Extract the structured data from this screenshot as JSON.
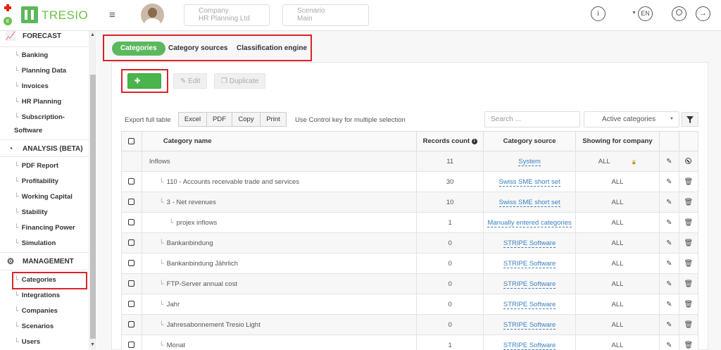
{
  "app": {
    "name": "TRESIO"
  },
  "header": {
    "company_label": "Company",
    "company_value": "HR Planning Ltd",
    "scenario_label": "Scenario",
    "scenario_value": "Main",
    "language": "EN"
  },
  "sidebar": {
    "sections": [
      {
        "title": "FORECAST",
        "icon": "chart-line-icon"
      },
      {
        "title": "ANALYSIS (BETA)",
        "icon": "pie-chart-icon"
      },
      {
        "title": "MANAGEMENT",
        "icon": "gear-icon"
      }
    ],
    "forecast_items": [
      "Banking",
      "Planning Data",
      "Invoices",
      "HR Planning",
      "Subscription-",
      "Software"
    ],
    "analysis_items": [
      "PDF Report",
      "Profitability",
      "Working Capital",
      "Stability",
      "Financing Power",
      "Simulation"
    ],
    "management_items": [
      "Categories",
      "Integrations",
      "Companies",
      "Scenarios",
      "Users"
    ]
  },
  "tabs": [
    {
      "label": "Categories",
      "active": true
    },
    {
      "label": "Category sources",
      "active": false
    },
    {
      "label": "Classification engine",
      "active": false
    }
  ],
  "toolbar": {
    "new_label": "New",
    "edit_label": "Edit",
    "duplicate_label": "Duplicate"
  },
  "export": {
    "label": "Export full table",
    "buttons": [
      "Excel",
      "PDF",
      "Copy",
      "Print"
    ],
    "hint": "Use Control key for multiple selection"
  },
  "search": {
    "placeholder": "Search ..."
  },
  "filter": {
    "selected": "Active categories"
  },
  "table": {
    "headers": {
      "name": "Category name",
      "count": "Records count",
      "source": "Category source",
      "showing": "Showing for company"
    },
    "rows": [
      {
        "name": "Inflows",
        "indent": 0,
        "checkbox": false,
        "count": "11",
        "source": "System",
        "showing": "ALL",
        "locked": true,
        "action": "ban"
      },
      {
        "name": "110 - Accounts receivable trade and services",
        "indent": 1,
        "checkbox": true,
        "count": "30",
        "source": "Swiss SME short set",
        "showing": "ALL",
        "action": "trash"
      },
      {
        "name": "3 - Net revenues",
        "indent": 1,
        "checkbox": true,
        "count": "10",
        "source": "Swiss SME short set",
        "showing": "ALL",
        "action": "trash"
      },
      {
        "name": "projex inflows",
        "indent": 2,
        "checkbox": true,
        "count": "1",
        "source": "Manually entered categories",
        "showing": "ALL",
        "action": "trash"
      },
      {
        "name": "Bankanbindung",
        "indent": 1,
        "checkbox": true,
        "count": "0",
        "source": "STRIPE Software",
        "showing": "ALL",
        "action": "trash"
      },
      {
        "name": "Bankanbindung Jährlich",
        "indent": 1,
        "checkbox": true,
        "count": "0",
        "source": "STRIPE Software",
        "showing": "ALL",
        "action": "trash"
      },
      {
        "name": "FTP-Server annual cost",
        "indent": 1,
        "checkbox": true,
        "count": "0",
        "source": "STRIPE Software",
        "showing": "ALL",
        "action": "trash"
      },
      {
        "name": "Jahr",
        "indent": 1,
        "checkbox": true,
        "count": "0",
        "source": "STRIPE Software",
        "showing": "ALL",
        "action": "trash"
      },
      {
        "name": "Jahresabonnement Tresio Light",
        "indent": 1,
        "checkbox": true,
        "count": "0",
        "source": "STRIPE Software",
        "showing": "ALL",
        "action": "trash"
      },
      {
        "name": "Monat",
        "indent": 1,
        "checkbox": true,
        "count": "1",
        "source": "STRIPE Software",
        "showing": "ALL",
        "action": "trash"
      }
    ]
  }
}
